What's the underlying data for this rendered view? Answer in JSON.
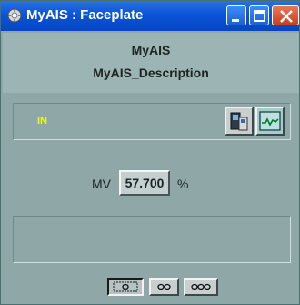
{
  "window": {
    "title": "MyAIS : Faceplate",
    "controls": [
      "minimize-icon",
      "maximize-icon",
      "close-icon"
    ]
  },
  "header": {
    "name": "MyAIS",
    "description": "MyAIS_Description"
  },
  "status": {
    "indicator": "IN",
    "indicator_color": "#e8ff00",
    "buttons": [
      "faceplate-icon",
      "trend-icon"
    ]
  },
  "measurement": {
    "label": "MV",
    "value": "57.700",
    "unit": "%"
  },
  "view_buttons": [
    "view-1-icon",
    "view-2-icon",
    "view-3-icon"
  ],
  "colors": {
    "titlebar": "#0a54d8",
    "background": "#8fa7a7"
  }
}
